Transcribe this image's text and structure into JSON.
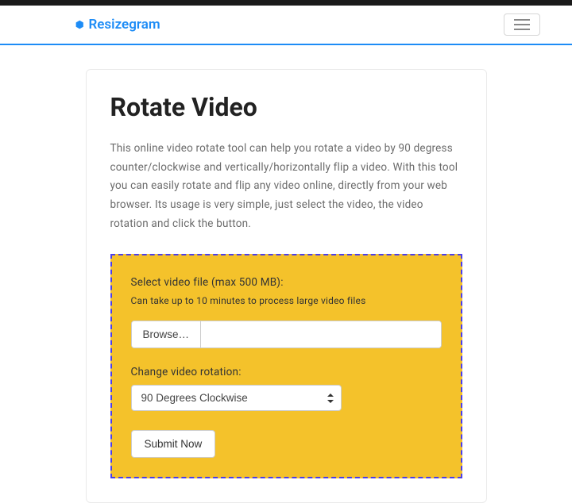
{
  "navbar": {
    "brand": "Resizegram"
  },
  "page": {
    "heading": "Rotate Video",
    "description": "This online video rotate tool can help you rotate a video by 90 degress counter/clockwise and vertically/horizontally flip a video. With this tool you can easily rotate and flip any video online, directly from your web browser. Its usage is very simple, just select the video, the video rotation and click the button."
  },
  "form": {
    "file_label": "Select video file (max 500 MB):",
    "file_note": "Can take up to 10 minutes to process large video files",
    "browse_label": "Browse…",
    "rotation_label": "Change video rotation:",
    "rotation_value": "90 Degrees Clockwise",
    "submit_label": "Submit Now"
  }
}
